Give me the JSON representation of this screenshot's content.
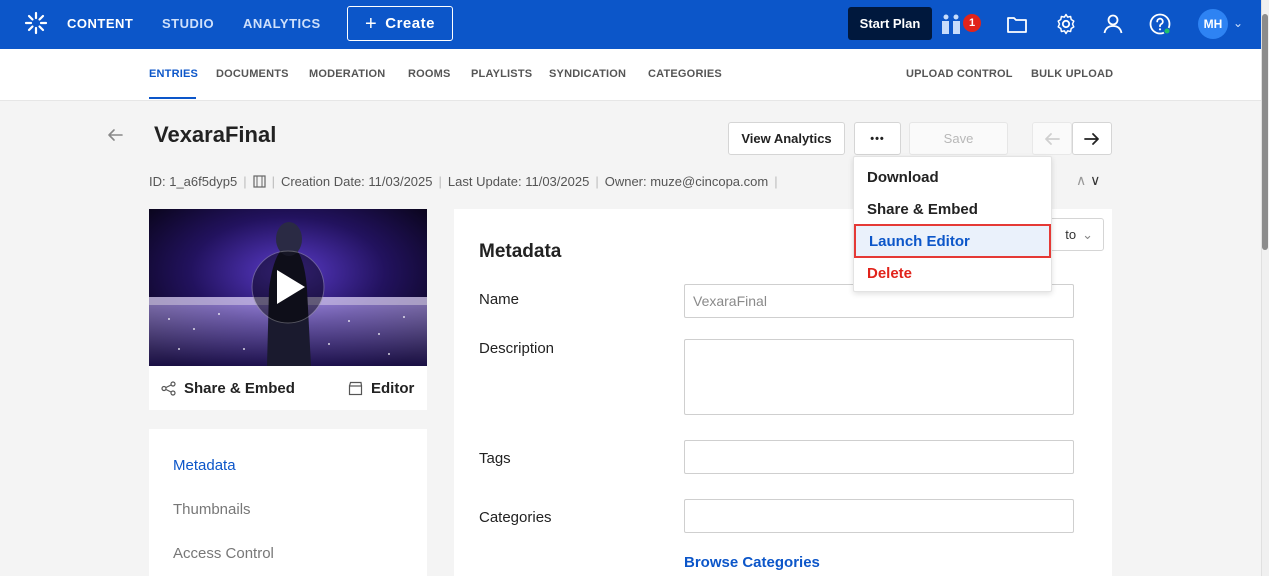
{
  "colors": {
    "brand": "#0c56c9",
    "danger": "#e1231b",
    "highlight_outline": "#e53935"
  },
  "topbar": {
    "nav": [
      "CONTENT",
      "STUDIO",
      "ANALYTICS"
    ],
    "create_label": "Create",
    "start_plan_label": "Start Plan",
    "notification_count": "1",
    "avatar_initials": "MH"
  },
  "subnav": {
    "left": [
      "ENTRIES",
      "DOCUMENTS",
      "MODERATION",
      "ROOMS",
      "PLAYLISTS",
      "SYNDICATION",
      "CATEGORIES"
    ],
    "right": [
      "UPLOAD CONTROL",
      "BULK UPLOAD"
    ]
  },
  "entry": {
    "title": "VexaraFinal",
    "id": "ID: 1_a6f5dyp5",
    "creation_date": "Creation Date: 11/03/2025",
    "last_update": "Last Update: 11/03/2025",
    "owner": "Owner: muze@cincopa.com"
  },
  "actions": {
    "view_analytics": "View Analytics",
    "more": "•••",
    "save": "Save"
  },
  "dropdown": {
    "items": [
      "Download",
      "Share & Embed",
      "Launch Editor",
      "Delete"
    ]
  },
  "thumb_actions": {
    "share": "Share & Embed",
    "editor": "Editor"
  },
  "left_nav": [
    "Metadata",
    "Thumbnails",
    "Access Control"
  ],
  "form": {
    "section_title": "Metadata",
    "jump_to": "to",
    "name_label": "Name",
    "name_value": "VexaraFinal",
    "description_label": "Description",
    "tags_label": "Tags",
    "categories_label": "Categories",
    "browse_categories": "Browse Categories"
  }
}
